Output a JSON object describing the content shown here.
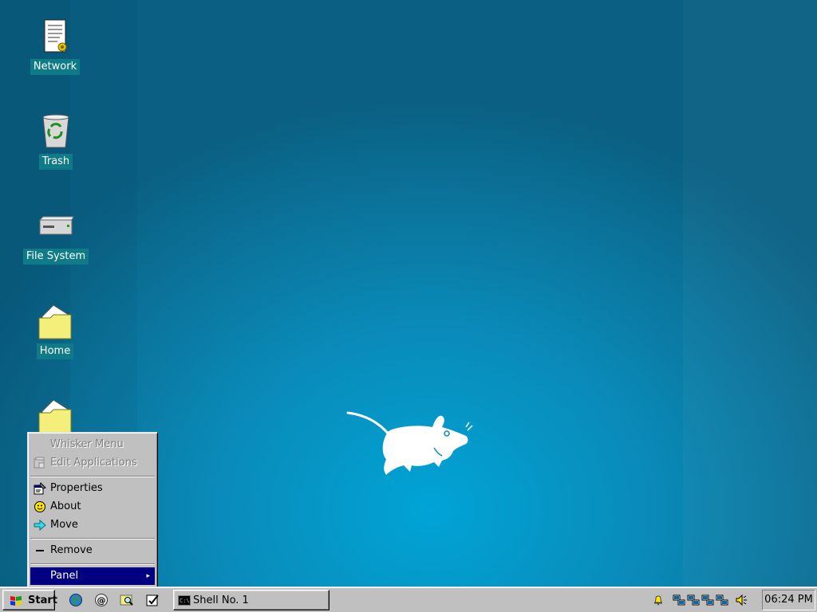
{
  "desktop": {
    "icons": [
      {
        "label": "Network",
        "icon": "network-document-icon"
      },
      {
        "label": "Trash",
        "icon": "trash-icon"
      },
      {
        "label": "File System",
        "icon": "drive-icon"
      },
      {
        "label": "Home",
        "icon": "folder-icon"
      },
      {
        "label": "",
        "icon": "folder-icon"
      }
    ],
    "wallpaper_mascot": "xfce-mouse"
  },
  "context_menu": {
    "items": [
      {
        "label": "Whisker Menu",
        "disabled": true,
        "icon": ""
      },
      {
        "label": "Edit Applications",
        "disabled": true,
        "icon": "edit-applications-icon"
      },
      {
        "label": "Properties",
        "disabled": false,
        "icon": "properties-icon"
      },
      {
        "label": "About",
        "disabled": false,
        "icon": "smiley-icon"
      },
      {
        "label": "Move",
        "disabled": false,
        "icon": "arrow-right-icon"
      },
      {
        "label": "Remove",
        "disabled": false,
        "icon": "minus-icon"
      },
      {
        "label": "Panel",
        "disabled": false,
        "selected": true,
        "icon": "",
        "submenu": true
      }
    ],
    "submenu_arrow": "▸"
  },
  "taskbar": {
    "start_label": "Start",
    "quick_launch": [
      "globe-icon",
      "terminal-icon",
      "search-folder-icon",
      "notepad-icon"
    ],
    "tasks": [
      {
        "label": "Shell No. 1",
        "icon": "shell-icon"
      }
    ],
    "tray_icons": [
      "bell-icon",
      "network-icon",
      "network-icon",
      "network-icon",
      "network-icon",
      "volume-icon"
    ],
    "clock": "06:24 PM"
  },
  "colors": {
    "desktop": "#0a8ab8",
    "menu_selection": "#000080",
    "icon_label_bg": "#0e7b86"
  }
}
